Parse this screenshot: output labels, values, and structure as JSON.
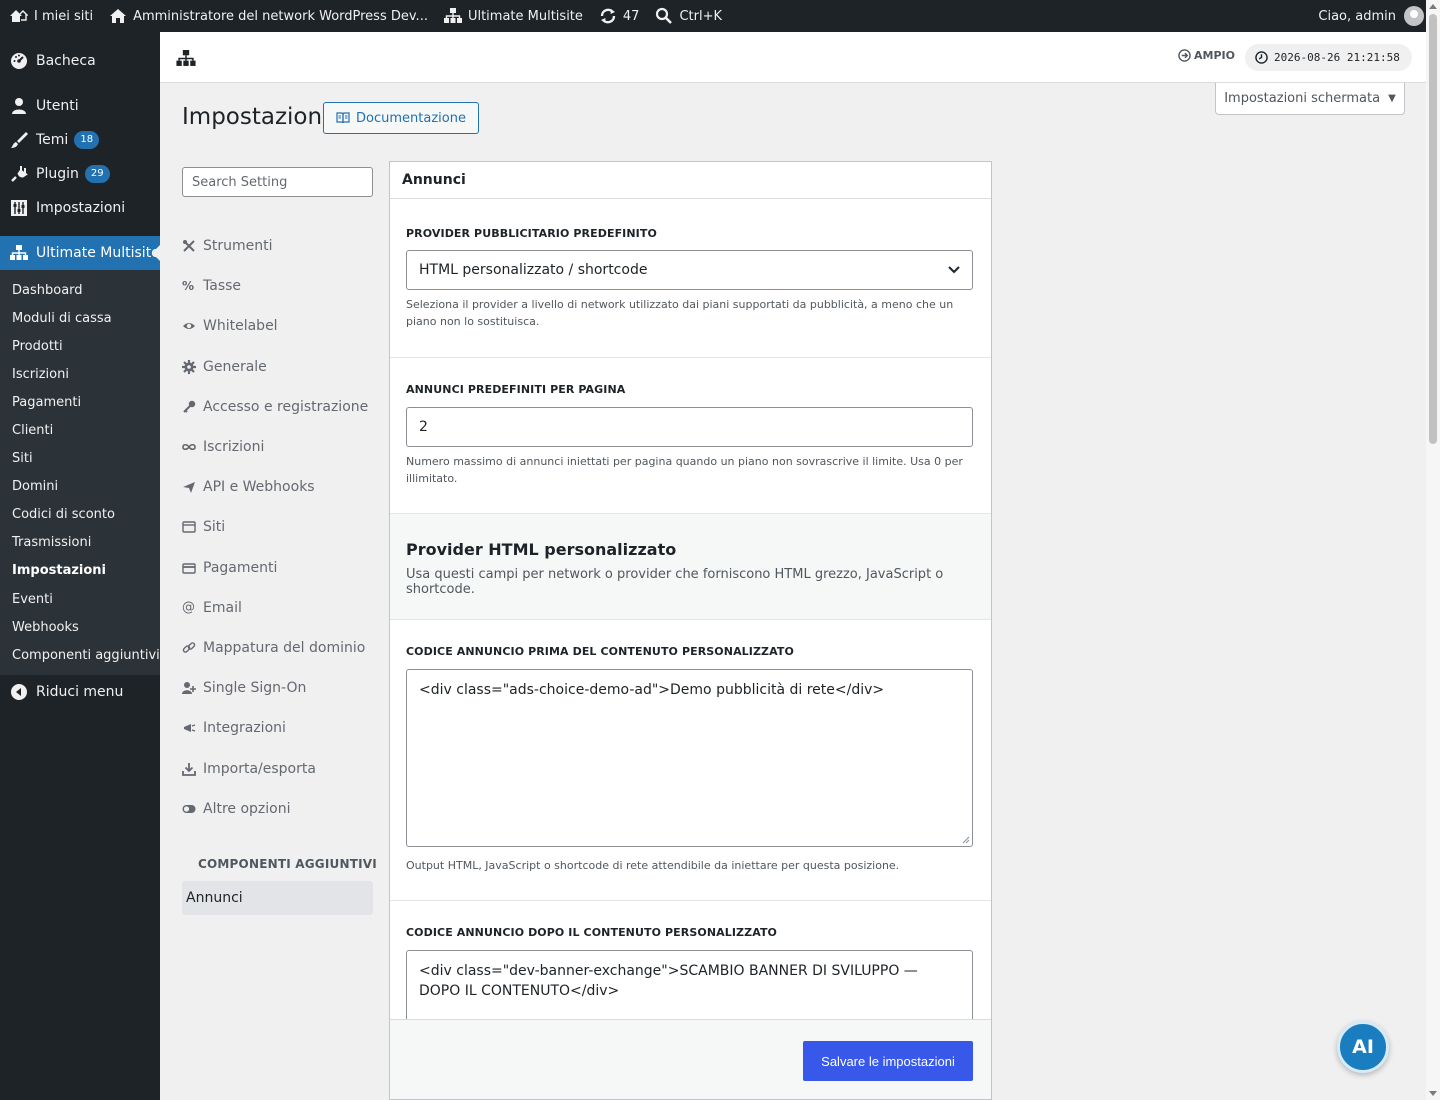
{
  "adminbar": {
    "my_sites": "I miei siti",
    "network_admin": "Amministratore del network WordPress Dev...",
    "ultimate_multisite": "Ultimate Multisite",
    "updates_count": "47",
    "search_shortcut": "Ctrl+K",
    "greeting": "Ciao, admin"
  },
  "sidebar": {
    "dashboard": "Bacheca",
    "users": "Utenti",
    "themes": "Temi",
    "themes_badge": "18",
    "plugins": "Plugin",
    "plugins_badge": "29",
    "settings": "Impostazioni",
    "multisite": "Ultimate Multisite",
    "submenu": [
      "Dashboard",
      "Moduli di cassa",
      "Prodotti",
      "Iscrizioni",
      "Pagamenti",
      "Clienti",
      "Siti",
      "Domini",
      "Codici di sconto",
      "Trasmissioni",
      "Impostazioni",
      "Eventi",
      "Webhooks",
      "Componenti aggiuntivi"
    ],
    "collapse": "Riduci menu"
  },
  "topbar": {
    "wide_label": "AMPIO",
    "clock": "2026-08-26 21:21:58"
  },
  "screen_options": "Impostazioni schermata",
  "page": {
    "title": "Impostazioni",
    "doc_button": "Documentazione"
  },
  "search": {
    "placeholder": "Search Setting"
  },
  "settings_nav": [
    "Strumenti",
    "Tasse",
    "Whitelabel",
    "Generale",
    "Accesso e registrazione",
    "Iscrizioni",
    "API e Webhooks",
    "Siti",
    "Pagamenti",
    "Email",
    "Mappatura del dominio",
    "Single Sign-On",
    "Integrazioni",
    "Importa/esporta",
    "Altre opzioni"
  ],
  "addons": {
    "label": "COMPONENTI AGGIUNTIVI",
    "ads": "Annunci"
  },
  "panel": {
    "title": "Annunci",
    "provider_label": "PROVIDER PUBBLICITARIO PREDEFINITO",
    "provider_value": "HTML personalizzato / shortcode",
    "provider_desc": "Seleziona il provider a livello di network utilizzato dai piani supportati da pubblicità, a meno che un piano non lo sostituisca.",
    "per_page_label": "ANNUNCI PREDEFINITI PER PAGINA",
    "per_page_value": "2",
    "per_page_desc": "Numero massimo di annunci iniettati per pagina quando un piano non sovrascrive il limite. Usa 0 per illimitato.",
    "section_title": "Provider HTML personalizzato",
    "section_desc": "Usa questi campi per network o provider che forniscono HTML grezzo, JavaScript o shortcode.",
    "before_label": "CODICE ANNUNCIO PRIMA DEL CONTENUTO PERSONALIZZATO",
    "before_value": "<div class=\"ads-choice-demo-ad\">Demo pubblicità di rete</div>",
    "before_desc": "Output HTML, JavaScript o shortcode di rete attendibile da iniettare per questa posizione.",
    "after_label": "CODICE ANNUNCIO DOPO IL CONTENUTO PERSONALIZZATO",
    "after_value": "<div class=\"dev-banner-exchange\">SCAMBIO BANNER DI SVILUPPO — DOPO IL CONTENUTO</div>",
    "save_button": "Salvare le impostazioni"
  },
  "ai_button": "AI"
}
